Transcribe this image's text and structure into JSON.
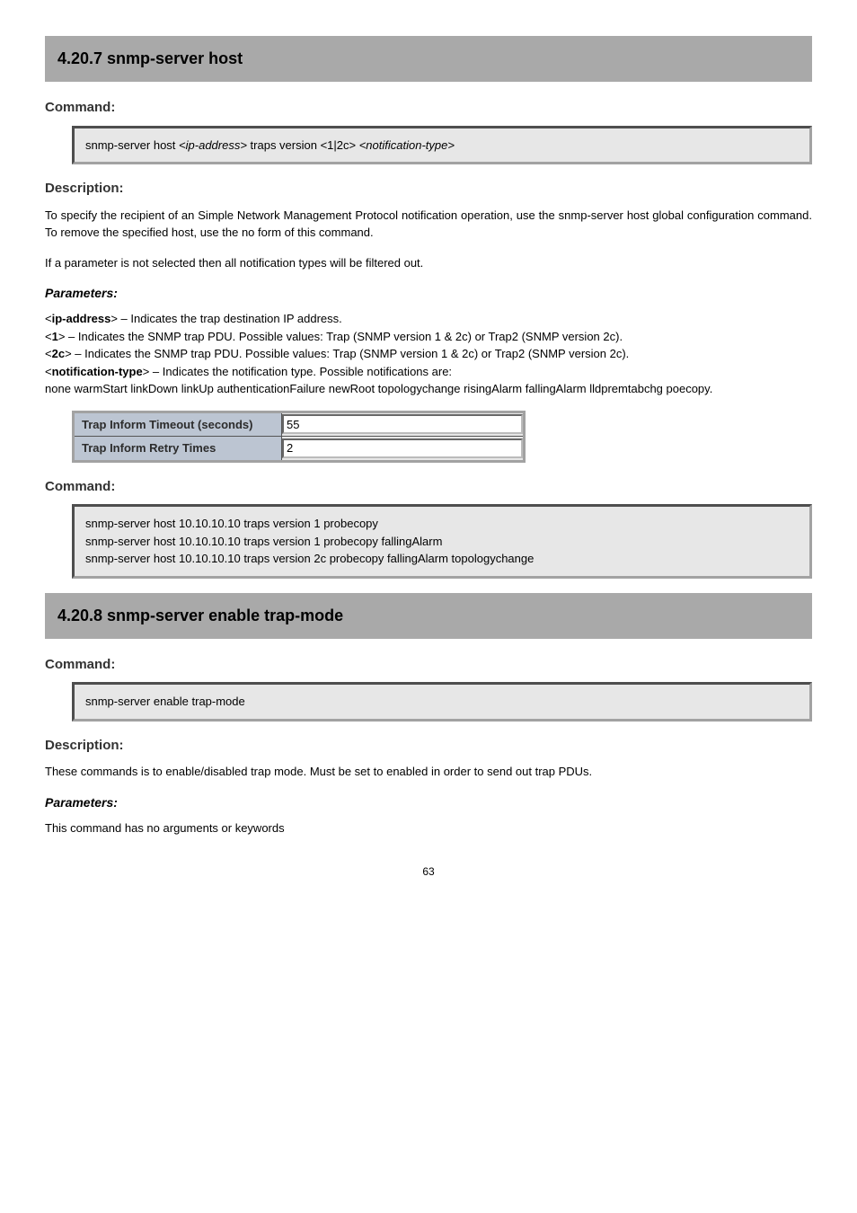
{
  "section1": {
    "title": "4.20.7 snmp-server host",
    "cmd_heading": "Command:",
    "cmd": "snmp-server host <ip-address> traps version <1|2c> <notification-type>",
    "desc_heading": "Description:",
    "desc1": "To specify the recipient of an Simple Network Management Protocol notification operation, use the snmp-server host global configuration command. To remove the specified host, use the no form of this command.",
    "desc2": "If a parameter is not selected then all notification types will be filtered out.",
    "param_heading": "Parameters:",
    "table": [
      {
        "label": "Trap Inform Timeout (seconds)",
        "value": "55"
      },
      {
        "label": "Trap Inform Retry Times",
        "value": "2"
      }
    ],
    "cmd2_heading": "Command:",
    "cmd2_lines": [
      "snmp-server host 10.10.10.10 traps version 1 probecopy",
      "snmp-server host 10.10.10.10 traps version 1 probecopy fallingAlarm",
      "snmp-server host 10.10.10.10 traps version 2c probecopy fallingAlarm topologychange"
    ]
  },
  "section2": {
    "title": "4.20.8 snmp-server enable trap-mode",
    "cmd_heading": "Command:",
    "cmd": "snmp-server enable trap-mode",
    "desc_heading": "Description:",
    "desc": "These commands is to enable/disabled trap mode. Must be set to enabled in order to send out trap PDUs.",
    "param_heading": "Parameters:",
    "param_note": "This command has no arguments or keywords"
  },
  "page_number": "63"
}
